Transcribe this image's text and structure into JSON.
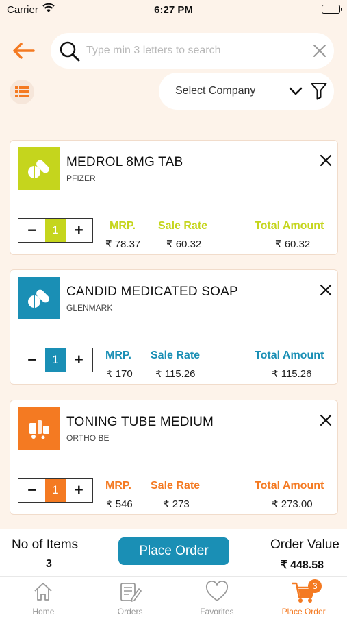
{
  "status_bar": {
    "carrier": "Carrier",
    "time": "6:27 PM"
  },
  "search": {
    "placeholder": "Type min 3 letters to search",
    "value": ""
  },
  "filter": {
    "company_label": "Select Company"
  },
  "colors": {
    "accent": "#f47a22",
    "blue": "#1a8fb5",
    "lime": "#c5d51d",
    "background": "#fdf3ea"
  },
  "products": [
    {
      "name": "MEDROL 8MG TAB",
      "company": "PFIZER",
      "quantity": "1",
      "mrp_label": "MRP.",
      "mrp": "₹ 78.37",
      "sale_rate_label": "Sale Rate",
      "sale_rate": "₹ 60.32",
      "total_label": "Total Amount",
      "total": "₹ 60.32",
      "color": "#c5d51d",
      "icon": "pill-icon"
    },
    {
      "name": "CANDID MEDICATED SOAP",
      "company": "GLENMARK",
      "quantity": "1",
      "mrp_label": "MRP.",
      "mrp": "₹ 170",
      "sale_rate_label": "Sale Rate",
      "sale_rate": "₹ 115.26",
      "total_label": "Total Amount",
      "total": "₹ 115.26",
      "color": "#1a8fb5",
      "icon": "pill-icon"
    },
    {
      "name": "TONING TUBE MEDIUM",
      "company": "ORTHO BE",
      "quantity": "1",
      "mrp_label": "MRP.",
      "mrp": "₹ 546",
      "sale_rate_label": "Sale Rate",
      "sale_rate": "₹ 273",
      "total_label": "Total Amount",
      "total": "₹ 273.00",
      "color": "#f47a22",
      "icon": "medical-supplies-icon"
    }
  ],
  "summary": {
    "items_label": "No of Items",
    "items_count": "3",
    "place_order_label": "Place Order",
    "order_value_label": "Order Value",
    "order_value": "₹ 448.58"
  },
  "tabs": [
    {
      "label": "Home",
      "icon": "home-icon"
    },
    {
      "label": "Orders",
      "icon": "orders-icon"
    },
    {
      "label": "Favorites",
      "icon": "heart-icon"
    },
    {
      "label": "Place Order",
      "icon": "cart-icon",
      "badge": "3",
      "active": true
    }
  ]
}
